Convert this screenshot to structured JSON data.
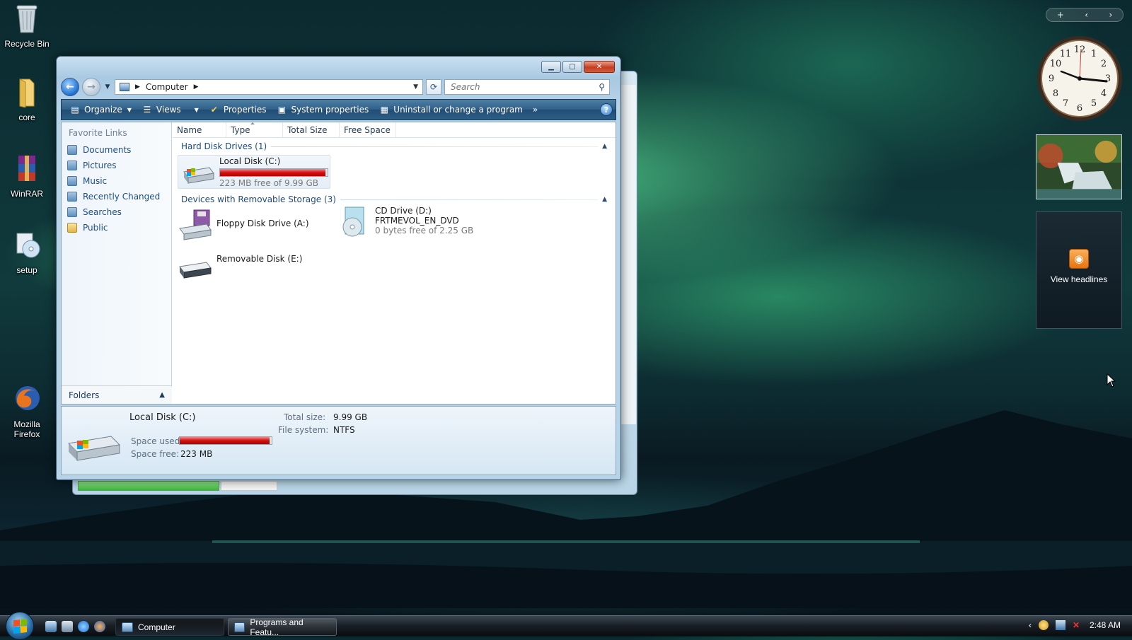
{
  "desktop": {
    "icons": [
      {
        "label": "Recycle Bin",
        "icon": "recycle-bin-icon"
      },
      {
        "label": "core",
        "icon": "folder-icon"
      },
      {
        "label": "WinRAR",
        "icon": "winrar-icon"
      },
      {
        "label": "setup",
        "icon": "setup-icon"
      },
      {
        "label": "Mozilla Firefox",
        "icon": "firefox-icon"
      }
    ]
  },
  "window": {
    "address": {
      "root": "Computer"
    },
    "search_placeholder": "Search",
    "toolbar": {
      "organize": "Organize",
      "views": "Views",
      "properties": "Properties",
      "system_properties": "System properties",
      "uninstall": "Uninstall or change a program",
      "more": "»",
      "help": "?"
    },
    "nav_pane": {
      "heading": "Favorite Links",
      "links": [
        "Documents",
        "Pictures",
        "Music",
        "Recently Changed",
        "Searches",
        "Public"
      ],
      "folders": "Folders"
    },
    "columns": [
      "Name",
      "Type",
      "Total Size",
      "Free Space"
    ],
    "groups": [
      {
        "title": "Hard Disk Drives (1)"
      },
      {
        "title": "Devices with Removable Storage (3)"
      }
    ],
    "drives": {
      "c": {
        "name": "Local Disk (C:)",
        "free_text": "223 MB free of 9.99 GB",
        "used_fraction": 0.978
      },
      "a": {
        "name": "Floppy Disk Drive (A:)"
      },
      "d": {
        "name": "CD Drive (D:)",
        "label": "FRTMEVOL_EN_DVD",
        "free_text": "0 bytes free of 2.25 GB"
      },
      "e": {
        "name": "Removable Disk (E:)"
      }
    },
    "details": {
      "title": "Local Disk (C:)",
      "space_used_label": "Space used:",
      "space_free_label": "Space free:",
      "space_free_value": "223 MB",
      "total_size_label": "Total size:",
      "total_size_value": "9.99 GB",
      "file_system_label": "File system:",
      "file_system_value": "NTFS",
      "used_fraction": 0.978
    }
  },
  "sidebar": {
    "controls": {
      "add": "+",
      "prev": "‹",
      "next": "›"
    },
    "feed_label": "View headlines"
  },
  "taskbar": {
    "buttons": [
      {
        "label": "Computer",
        "active": true
      },
      {
        "label": "Programs and Featu...",
        "active": false
      }
    ],
    "time": "2:48 AM"
  },
  "colors": {
    "capacity_bar": "#d30f0f",
    "toolbar": "#2f5f88",
    "link": "#1a4f8c"
  }
}
